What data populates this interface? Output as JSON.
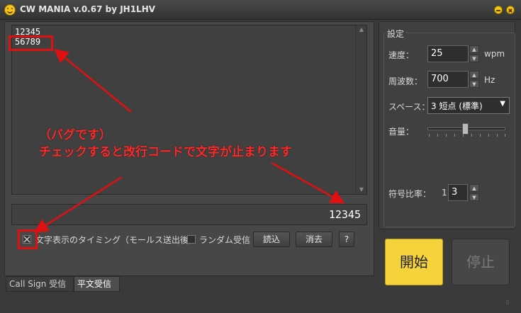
{
  "window": {
    "title": "CW MANIA v.0.67 by JH1LHV"
  },
  "receive_area": {
    "lines": [
      "12345",
      "56789"
    ]
  },
  "code_display": {
    "value": "12345"
  },
  "options": {
    "char_timing_label": "文字表示のタイミング（モールス送出後）",
    "char_timing_checked": true,
    "random_label": "ランダム受信",
    "random_checked": false
  },
  "buttons": {
    "load": "読込",
    "clear": "消去",
    "help": "?",
    "start": "開始",
    "stop": "停止"
  },
  "tabs": [
    {
      "label": "Call Sign 受信",
      "active": false
    },
    {
      "label": "平文受信",
      "active": true
    }
  ],
  "settings": {
    "group_label": "設定",
    "speed": {
      "label": "速度：",
      "value": "25",
      "unit": "wpm"
    },
    "frequency": {
      "label": "周波数：",
      "value": "700",
      "unit": "Hz"
    },
    "space": {
      "label": "スペース：",
      "value": "3 短点 (標準)"
    },
    "volume": {
      "label": "音量：",
      "level_fraction": 0.5
    },
    "ratio": {
      "label": "符号比率：",
      "prefix": "1",
      "value": "3"
    }
  },
  "annotation": {
    "line1": "（バグです）",
    "line2": "チェックすると改行コードで文字が止まります"
  },
  "colors": {
    "annotation_red": "#e01010",
    "start_yellow": "#f5d33a",
    "background": "#3a3a3a"
  }
}
